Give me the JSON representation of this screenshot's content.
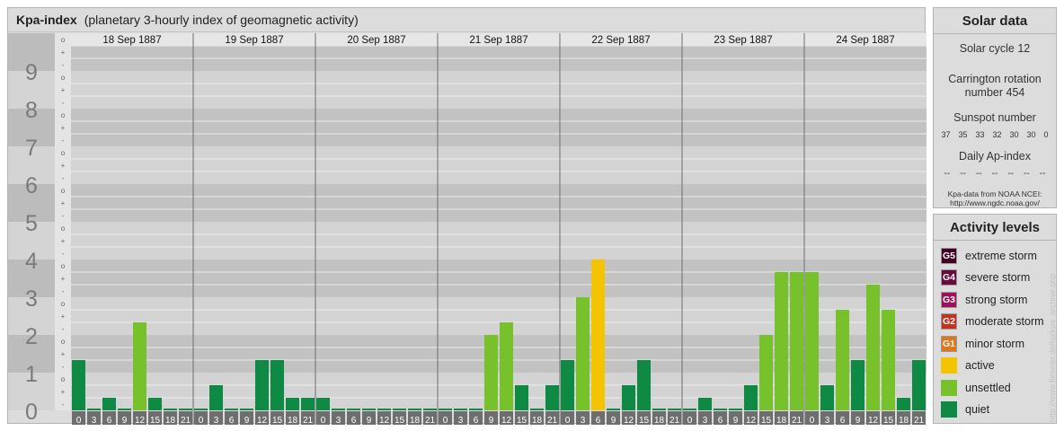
{
  "header": {
    "title": "Kpa-index",
    "subtitle": "(planetary 3-hourly index of geomagnetic activity)"
  },
  "chart_data": {
    "type": "bar",
    "ylim": [
      0,
      9
    ],
    "y_ticks": [
      "0",
      "1",
      "2",
      "3",
      "4",
      "5",
      "6",
      "7",
      "8",
      "9"
    ],
    "sub_ticks": [
      "o",
      "+",
      "-"
    ],
    "days": [
      "18 Sep 1887",
      "19 Sep 1887",
      "20 Sep 1887",
      "21 Sep 1887",
      "22 Sep 1887",
      "23 Sep 1887",
      "24 Sep 1887"
    ],
    "interval_starts": [
      "0",
      "3",
      "6",
      "9",
      "12",
      "15",
      "18",
      "21"
    ],
    "interval_ends": [
      "3",
      "6",
      "9",
      "12",
      "15",
      "18",
      "21",
      "24"
    ],
    "values": [
      [
        1.333,
        0,
        0.333,
        0,
        2.333,
        0.333,
        0,
        0
      ],
      [
        0,
        0.667,
        0,
        0,
        1.333,
        1.333,
        0.333,
        0.333
      ],
      [
        0.333,
        0,
        0,
        0,
        0,
        0,
        0,
        0
      ],
      [
        0,
        0,
        0,
        2,
        2.333,
        0.667,
        0,
        0.667
      ],
      [
        1.333,
        3,
        4,
        0,
        0.667,
        1.333,
        0,
        0
      ],
      [
        0,
        0.333,
        0,
        0,
        0.667,
        2,
        3.667,
        3.667
      ],
      [
        3.667,
        0.667,
        2.667,
        1.333,
        3.333,
        2.667,
        0.333,
        1.333
      ]
    ]
  },
  "solar_data": {
    "title": "Solar data",
    "cycle": "Solar cycle 12",
    "rotation_line1": "Carrington rotation",
    "rotation_line2": "number 454",
    "sunspot_label": "Sunspot number",
    "sunspots": [
      "37",
      "35",
      "33",
      "32",
      "30",
      "30",
      "0"
    ],
    "ap_label": "Daily Ap-index",
    "ap_values": [
      "--",
      "--",
      "--",
      "--",
      "--",
      "--",
      "--"
    ],
    "source_line1": "Kpa-data from NOAA NCEI:",
    "source_line2": "http://www.ngdc.noaa.gov/"
  },
  "activity_levels": {
    "title": "Activity levels",
    "items": [
      {
        "badge": "G5",
        "label": "extreme storm",
        "color": "#440022"
      },
      {
        "badge": "G4",
        "label": "severe storm",
        "color": "#6a0a3c"
      },
      {
        "badge": "G3",
        "label": "strong storm",
        "color": "#a0105a"
      },
      {
        "badge": "G2",
        "label": "moderate storm",
        "color": "#c23220"
      },
      {
        "badge": "G1",
        "label": "minor storm",
        "color": "#e0761a"
      },
      {
        "badge": "",
        "label": "active",
        "color": "#f5c400"
      },
      {
        "badge": "",
        "label": "unsettled",
        "color": "#77c12a"
      },
      {
        "badge": "",
        "label": "quiet",
        "color": "#0e8a44"
      }
    ]
  },
  "colors": {
    "quiet": "#0e8a44",
    "unsettled": "#77c12a",
    "active": "#f5c400"
  },
  "credit": "http://www.fieseler.de/kp/kpa_archive.php"
}
